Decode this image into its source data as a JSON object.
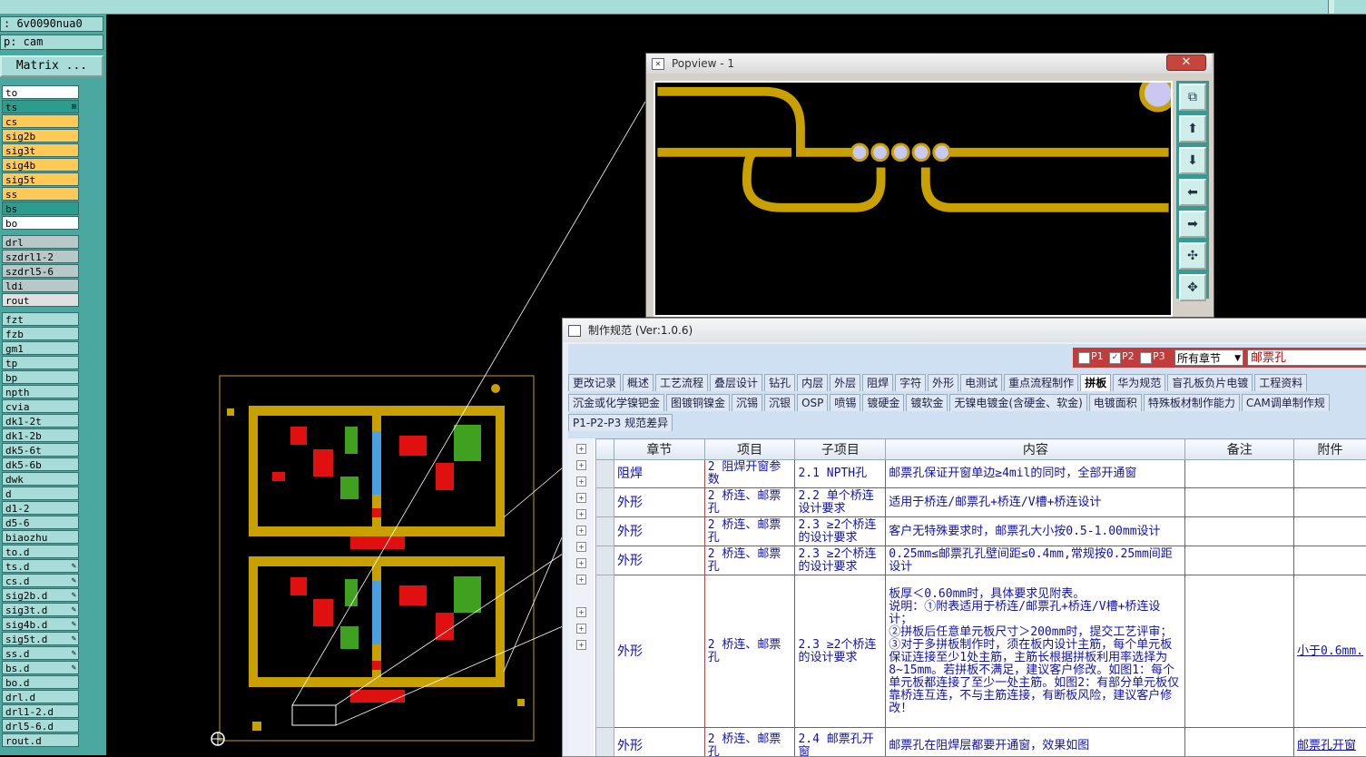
{
  "topbar": {
    "job_label": ": 6v0090nua0",
    "step_label": "p: cam",
    "matrix_button": "Matrix ..."
  },
  "layers": [
    {
      "name": "to",
      "bg": "#ffffff"
    },
    {
      "name": "ts",
      "bg": "#2a9d8f",
      "mark": "⊞"
    },
    {
      "name": "cs",
      "bg": "#ffc857"
    },
    {
      "name": "sig2b",
      "bg": "#ffc857"
    },
    {
      "name": "sig3t",
      "bg": "#ffc857"
    },
    {
      "name": "sig4b",
      "bg": "#ffc857"
    },
    {
      "name": "sig5t",
      "bg": "#ffc857"
    },
    {
      "name": "ss",
      "bg": "#ffc857"
    },
    {
      "name": "bs",
      "bg": "#2a9d8f"
    },
    {
      "name": "bo",
      "bg": "#ffffff",
      "gap_after": true
    },
    {
      "name": "drl",
      "bg": "#b8c8c8"
    },
    {
      "name": "szdrl1-2",
      "bg": "#b8c8c8"
    },
    {
      "name": "szdrl5-6",
      "bg": "#b8c8c8"
    },
    {
      "name": "ldi",
      "bg": "#b8c8c8"
    },
    {
      "name": "rout",
      "bg": "#e0e0e0",
      "gap_after": true
    },
    {
      "name": "fzt",
      "bg": "#a8dcd8"
    },
    {
      "name": "fzb",
      "bg": "#a8dcd8"
    },
    {
      "name": "gm1",
      "bg": "#a8dcd8"
    },
    {
      "name": "tp",
      "bg": "#a8dcd8"
    },
    {
      "name": "bp",
      "bg": "#a8dcd8"
    },
    {
      "name": "npth",
      "bg": "#a8dcd8"
    },
    {
      "name": "cvia",
      "bg": "#a8dcd8"
    },
    {
      "name": "dk1-2t",
      "bg": "#a8dcd8"
    },
    {
      "name": "dk1-2b",
      "bg": "#a8dcd8"
    },
    {
      "name": "dk5-6t",
      "bg": "#a8dcd8"
    },
    {
      "name": "dk5-6b",
      "bg": "#a8dcd8"
    },
    {
      "name": "dwk",
      "bg": "#a8dcd8"
    },
    {
      "name": "d",
      "bg": "#a8dcd8"
    },
    {
      "name": "d1-2",
      "bg": "#a8dcd8"
    },
    {
      "name": "d5-6",
      "bg": "#a8dcd8"
    },
    {
      "name": "biaozhu",
      "bg": "#a8dcd8"
    },
    {
      "name": "to.d",
      "bg": "#a8dcd8"
    },
    {
      "name": "ts.d",
      "bg": "#a8dcd8",
      "mark": "✎"
    },
    {
      "name": "cs.d",
      "bg": "#a8dcd8",
      "mark": "✎"
    },
    {
      "name": "sig2b.d",
      "bg": "#a8dcd8",
      "mark": "✎"
    },
    {
      "name": "sig3t.d",
      "bg": "#a8dcd8",
      "mark": "✎"
    },
    {
      "name": "sig4b.d",
      "bg": "#a8dcd8",
      "mark": "✎"
    },
    {
      "name": "sig5t.d",
      "bg": "#a8dcd8",
      "mark": "✎"
    },
    {
      "name": "ss.d",
      "bg": "#a8dcd8",
      "mark": "✎"
    },
    {
      "name": "bs.d",
      "bg": "#a8dcd8",
      "mark": "✎"
    },
    {
      "name": "bo.d",
      "bg": "#a8dcd8"
    },
    {
      "name": "drl.d",
      "bg": "#a8dcd8"
    },
    {
      "name": "drl1-2.d",
      "bg": "#a8dcd8"
    },
    {
      "name": "drl5-6.d",
      "bg": "#a8dcd8"
    },
    {
      "name": "rout.d",
      "bg": "#a8dcd8"
    }
  ],
  "popview": {
    "title": "Popview - 1",
    "close": "✕"
  },
  "spec": {
    "title": "制作规范 (Ver:1.0.6)",
    "filter": {
      "p1": "P1",
      "p2": "P2",
      "p3": "P3",
      "chapter": "所有章节",
      "search": "邮票孔"
    },
    "tabs_row1": [
      "更改记录",
      "概述",
      "工艺流程",
      "叠层设计",
      "钻孔",
      "内层",
      "外层",
      "阻焊",
      "字符",
      "外形",
      "电测试",
      "重点流程制作",
      "拼板",
      "华为规范",
      "盲孔板负片电镀",
      "工程资料"
    ],
    "active_tab": "拼板",
    "tabs_row2": [
      "沉金或化学镍钯金",
      "图镀铜镍金",
      "沉锡",
      "沉银",
      "OSP",
      "喷锡",
      "镀硬金",
      "镀软金",
      "无镍电镀金(含硬金、软金)",
      "电镀面积",
      "特殊板材制作能力",
      "CAM调单制作规"
    ],
    "tabs_row3": [
      "P1-P2-P3 规范差异"
    ],
    "headers": [
      "章节",
      "项目",
      "子项目",
      "内容",
      "备注",
      "附件"
    ],
    "rows": [
      {
        "c1": "阻焊",
        "c2": "2 阻焊开窗参数",
        "c3": "2.1 NPTH孔",
        "c4": "邮票孔保证开窗单边≥4mil的同时，全部开通窗",
        "c5": "",
        "c6": ""
      },
      {
        "c1": "外形",
        "c2": "2 桥连、邮票孔",
        "c3": "2.2 单个桥连设计要求",
        "c4": "适用于桥连/邮票孔+桥连/V槽+桥连设计",
        "c5": "",
        "c6": ""
      },
      {
        "c1": "外形",
        "c2": "2 桥连、邮票孔",
        "c3": "2.3 ≥2个桥连的设计要求",
        "c4": "客户无特殊要求时，邮票孔大小按0.5-1.00mm设计",
        "c5": "",
        "c6": ""
      },
      {
        "c1": "外形",
        "c2": "2 桥连、邮票孔",
        "c3": "2.3 ≥2个桥连的设计要求",
        "c4": "0.25mm≤邮票孔孔壁间距≤0.4mm,常规按0.25mm间距设计",
        "c5": "",
        "c6": ""
      },
      {
        "c1": "外形",
        "c2": "2 桥连、邮票孔",
        "c3": "2.3 ≥2个桥连的设计要求",
        "c4": "板厚＜0.60mm时，具体要求见附表。\n说明：①附表适用于桥连/邮票孔+桥连/V槽+桥连设计；\n②拼板后任意单元板尺寸＞200mm时，提交工艺评审；\n③对于多拼板制作时，须在板内设计主筋，每个单元板保证连接至少1处主筋，主筋长根据拼板利用率选择为8~15mm。若拼板不满足，建议客户修改。如图1：每个单元板都连接了至少一处主筋。如图2：有部分单元板仅靠桥连互连，不与主筋连接，有断板风险，建议客户修改！",
        "c5": "",
        "c6": "小于0.6mm."
      },
      {
        "c1": "外形",
        "c2": "2 桥连、邮票孔",
        "c3": "2.4 邮票孔开窗",
        "c4": "邮票孔在阻焊层都要开通窗，效果如图",
        "c5": "",
        "c6": "邮票孔开窗"
      }
    ]
  },
  "colors": {
    "copper": "#c8a000",
    "pad": "#c8c8f0",
    "arrow": "#22dd22"
  }
}
